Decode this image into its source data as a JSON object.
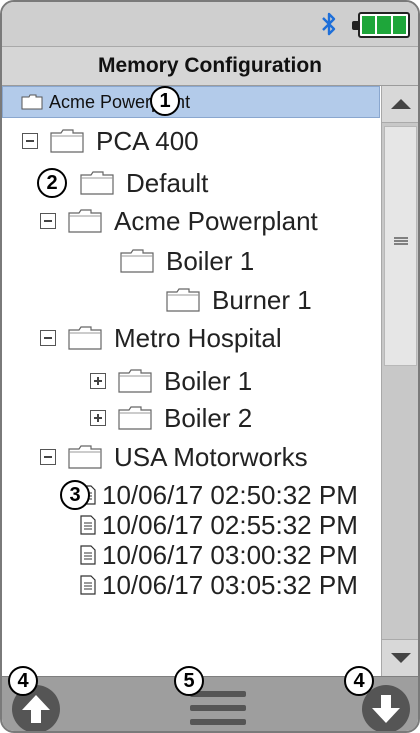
{
  "status": {
    "bluetooth_icon": "bluetooth-icon",
    "battery_icon": "battery-full-icon",
    "battery_color": "#1ea63a"
  },
  "title": "Memory Configuration",
  "path": {
    "label": "Acme Powerplant"
  },
  "tree": {
    "pca400": "PCA 400",
    "default": "Default",
    "acme": "Acme Powerplant",
    "acme_boiler1": "Boiler 1",
    "acme_burner1": "Burner 1",
    "metro": "Metro Hospital",
    "metro_boiler1": "Boiler 1",
    "metro_boiler2": "Boiler 2",
    "usa": "USA Motorworks",
    "records": [
      "10/06/17 02:50:32 PM",
      "10/06/17 02:55:32 PM",
      "10/06/17 03:00:32 PM",
      "10/06/17 03:05:32 PM"
    ]
  },
  "callouts": {
    "c1": "1",
    "c2": "2",
    "c3": "3",
    "c4a": "4",
    "c5": "5",
    "c4b": "4"
  },
  "bottom": {
    "up_icon": "arrow-up-icon",
    "menu_icon": "menu-icon",
    "down_icon": "arrow-down-icon"
  },
  "colors": {
    "selection": "#b3cbea",
    "bars": "#cfcfcf",
    "bottom_bar": "#9e9e9e"
  }
}
